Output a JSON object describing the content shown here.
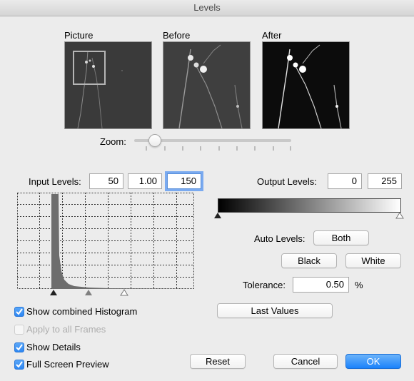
{
  "window": {
    "title": "Levels"
  },
  "previews": {
    "picture_label": "Picture",
    "before_label": "Before",
    "after_label": "After"
  },
  "zoom": {
    "label": "Zoom:",
    "level": 0.1
  },
  "input_levels": {
    "label": "Input Levels:",
    "black": "50",
    "gamma": "1.00",
    "white": "150"
  },
  "output_levels": {
    "label": "Output Levels:",
    "black": "0",
    "white": "255"
  },
  "auto_levels": {
    "label": "Auto Levels:",
    "both": "Both",
    "black": "Black",
    "white": "White"
  },
  "tolerance": {
    "label": "Tolerance:",
    "value": "0.50",
    "unit": "%"
  },
  "last_values": "Last Values",
  "options": [
    {
      "label": "Show combined Histogram",
      "checked": true,
      "enabled": true
    },
    {
      "label": "Apply to all Frames",
      "checked": false,
      "enabled": false
    },
    {
      "label": "Show Details",
      "checked": true,
      "enabled": true
    },
    {
      "label": "Full Screen Preview",
      "checked": true,
      "enabled": true
    }
  ],
  "buttons": {
    "reset": "Reset",
    "cancel": "Cancel",
    "ok": "OK"
  },
  "colors": {
    "accent": "#2d86f2",
    "preview_bg": "#3c3c3c",
    "histogram": "#6d6d6d"
  }
}
